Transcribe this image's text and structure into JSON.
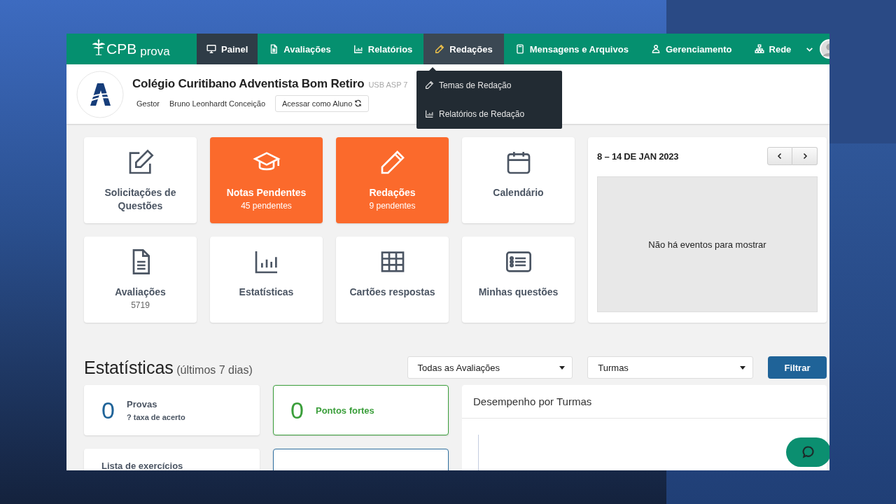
{
  "brand": {
    "name": "CPB",
    "product": "prova"
  },
  "nav": [
    {
      "label": "Painel",
      "selected": true,
      "open": false
    },
    {
      "label": "Avaliações",
      "selected": false,
      "open": false
    },
    {
      "label": "Relatórios",
      "selected": false,
      "open": false
    },
    {
      "label": "Redações",
      "selected": false,
      "open": true
    },
    {
      "label": "Mensagens e Arquivos",
      "selected": false,
      "open": false
    },
    {
      "label": "Gerenciamento",
      "selected": false,
      "open": false
    },
    {
      "label": "Rede",
      "selected": false,
      "open": false
    }
  ],
  "dropdown": [
    "Temas de Redação",
    "Relatórios de Redação"
  ],
  "school": {
    "name": "Colégio Curitibano Adventista Bom Retiro",
    "code": "USB ASP 7",
    "role": "Gestor",
    "user": "Bruno Leonhardt Conceição",
    "button": "Acessar como Aluno"
  },
  "tiles": [
    {
      "label": "Solicitações de Questões",
      "highlighted": false
    },
    {
      "label": "Notas Pendentes",
      "sub": "45 pendentes",
      "highlighted": true
    },
    {
      "label": "Redações",
      "sub": "9 pendentes",
      "highlighted": true
    },
    {
      "label": "Calendário",
      "highlighted": false
    },
    {
      "label": "Avaliações",
      "sub": "5719",
      "highlighted": false
    },
    {
      "label": "Estatísticas",
      "highlighted": false
    },
    {
      "label": "Cartões respostas",
      "highlighted": false
    },
    {
      "label": "Minhas questões",
      "highlighted": false
    }
  ],
  "calendar": {
    "range": "8 – 14 DE JAN 2023",
    "empty": "Não há eventos para mostrar"
  },
  "stats": {
    "title": "Estatísticas",
    "period": "(últimos 7 dias)",
    "filters": [
      "Todas as Avaliações",
      "Turmas"
    ],
    "button": "Filtrar",
    "cards": [
      {
        "value": "0",
        "label": "Provas",
        "sub": "? taxa de acerto",
        "color": "#1f6398"
      },
      {
        "value": "0",
        "label": "Pontos fortes",
        "color": "#3a9e3a"
      },
      {
        "label": "Lista de exercícios"
      },
      {
        "color": "#2f6fa0"
      }
    ],
    "chart_title": "Desempenho por Turmas"
  }
}
